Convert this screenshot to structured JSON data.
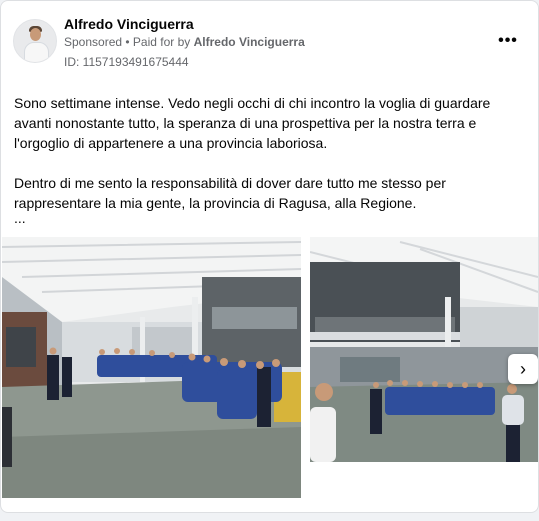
{
  "post": {
    "author": "Alfredo Vinciguerra",
    "sponsored": "Sponsored",
    "separator": " • ",
    "paid_prefix": "Paid for by ",
    "paid_by": "Alfredo Vinciguerra",
    "ad_id": "ID: 1157193491675444",
    "more_icon": "more-horizontal-icon",
    "more_glyph": "•••",
    "paragraph_1": "Sono settimane intense. Vedo negli occhi di chi incontro la voglia di guardare avanti nonostante tutto, la speranza di una prospettiva per la nostra terra e l'orgoglio di appartenere a una provincia laboriosa.",
    "paragraph_2": "Dentro di me sento la responsabilità di dover dare tutto me stesso per rappresentare la mia gente, la provincia di Ragusa, alla Regione.",
    "truncation": "...",
    "next_icon": "chevron-right-icon",
    "next_glyph": "›"
  },
  "colors": {
    "page_bg": "#f0f2f5",
    "card_bg": "#ffffff",
    "text_primary": "#050505",
    "text_secondary": "#65676b",
    "workers_shirts": "#2f4e9c"
  }
}
